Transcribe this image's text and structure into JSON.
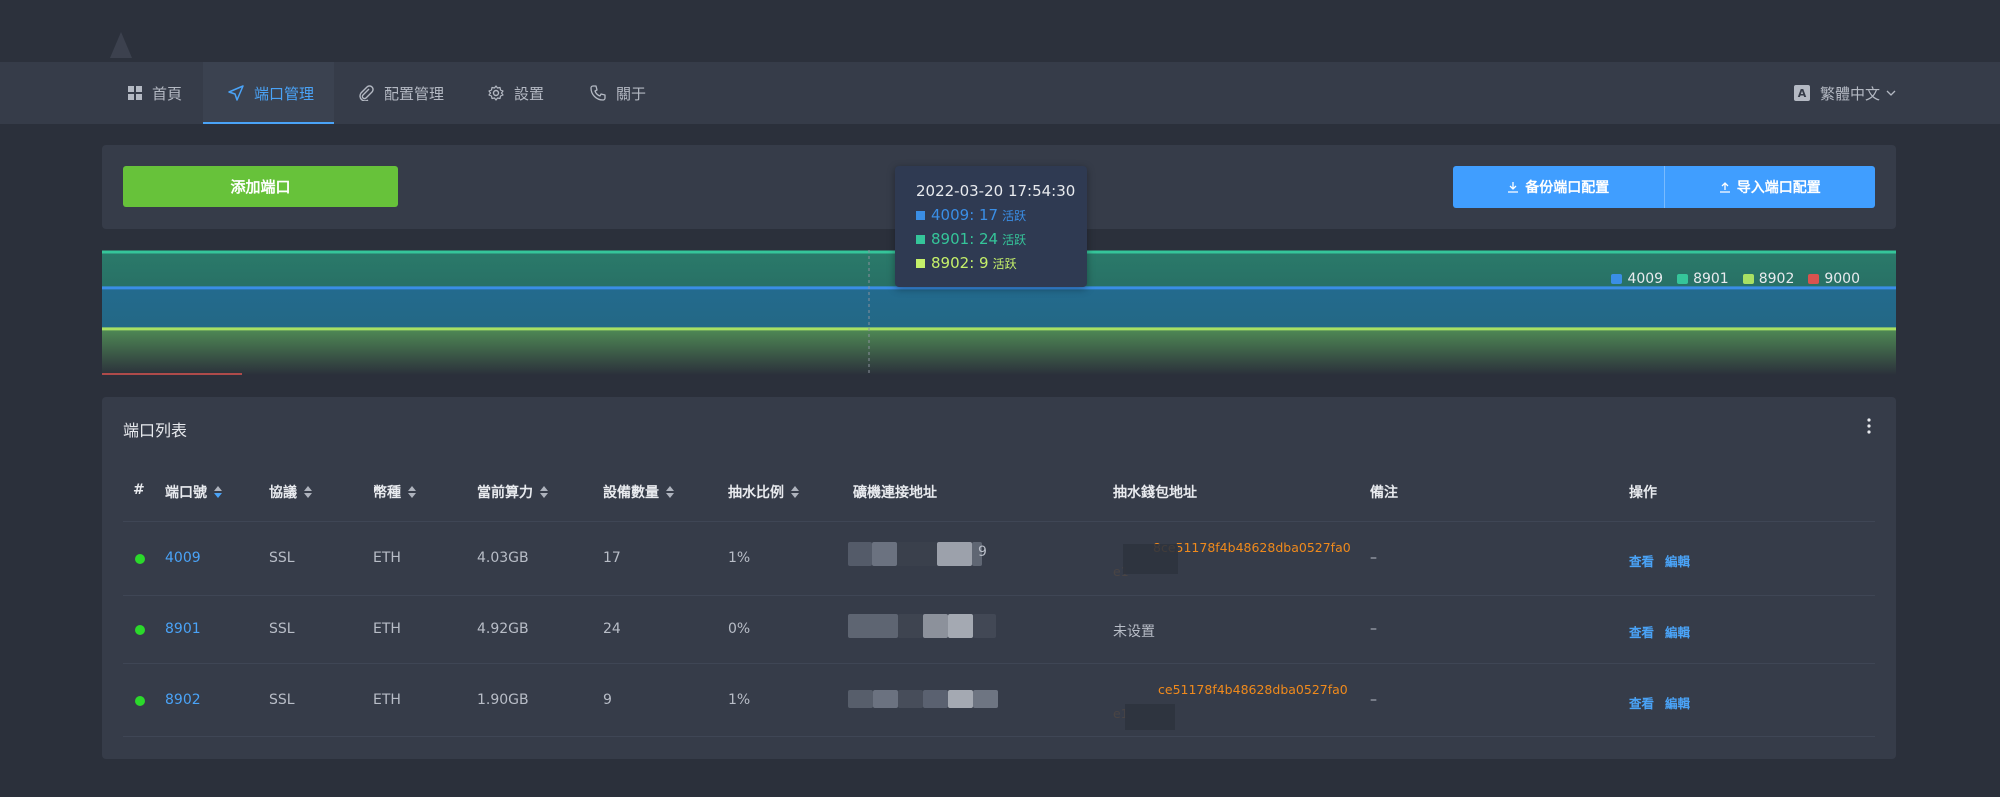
{
  "nav": {
    "items": [
      {
        "label": "首頁",
        "icon": "grid-icon"
      },
      {
        "label": "端口管理",
        "icon": "send-icon",
        "active": true
      },
      {
        "label": "配置管理",
        "icon": "paperclip-icon"
      },
      {
        "label": "設置",
        "icon": "gear-icon"
      },
      {
        "label": "關于",
        "icon": "phone-icon"
      }
    ],
    "language": "繁體中文"
  },
  "toolbar": {
    "add_label": "添加端口",
    "backup_label": "备份端口配置",
    "import_label": "导入端口配置"
  },
  "colors": {
    "accent": "#4aa3f7",
    "add_button": "#67c23a",
    "online": "#2bd92b",
    "wallet": "#f08a1c"
  },
  "chart_data": {
    "type": "area",
    "series": [
      {
        "name": "4009",
        "values": [
          17,
          17
        ],
        "color": "#3a8ee6"
      },
      {
        "name": "8901",
        "values": [
          24,
          24
        ],
        "color": "#35c59a"
      },
      {
        "name": "8902",
        "values": [
          9,
          9
        ],
        "color": "#a8e063"
      },
      {
        "name": "9000",
        "values": [],
        "color": "#d9534f"
      }
    ],
    "tooltip": {
      "time": "2022-03-20 17:54:30",
      "rows": [
        {
          "port": "4009",
          "value": "17",
          "unit": "活跃"
        },
        {
          "port": "8901",
          "value": "24",
          "unit": "活跃"
        },
        {
          "port": "8902",
          "value": "9",
          "unit": "活跃"
        }
      ]
    },
    "legend_position": "top-right",
    "grid": false
  },
  "table": {
    "title": "端口列表",
    "headers": {
      "index": "#",
      "port": "端口號",
      "protocol": "協議",
      "coin": "幣種",
      "hashrate": "當前算力",
      "devices": "設備數量",
      "fee": "抽水比例",
      "miner_addr": "礦機連接地址",
      "wallet": "抽水錢包地址",
      "note": "備注",
      "actions": "操作"
    },
    "rows": [
      {
        "port": "4009",
        "protocol": "SSL",
        "coin": "ETH",
        "hashrate": "4.03GB",
        "devices": "17",
        "fee": "1%",
        "miner_tail": "9",
        "wallet_l1": "8ce51178f4b48628dba0527fa0",
        "wallet_l2": "e1",
        "note": "–"
      },
      {
        "port": "8901",
        "protocol": "SSL",
        "coin": "ETH",
        "hashrate": "4.92GB",
        "devices": "24",
        "fee": "0%",
        "miner_tail": "",
        "wallet_l1": "未设置",
        "wallet_l2": "",
        "note": "–"
      },
      {
        "port": "8902",
        "protocol": "SSL",
        "coin": "ETH",
        "hashrate": "1.90GB",
        "devices": "9",
        "fee": "1%",
        "miner_tail": "",
        "wallet_l1": "ce51178f4b48628dba0527fa0",
        "wallet_l2": "e1",
        "note": "–"
      }
    ],
    "view_label": "查看",
    "edit_label": "編輯"
  }
}
